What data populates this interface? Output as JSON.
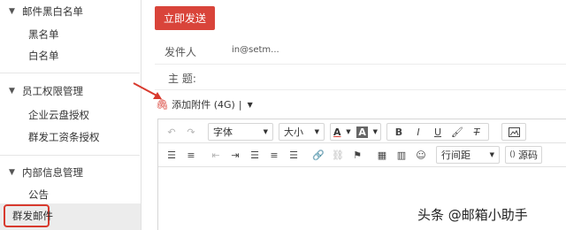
{
  "sidebar": {
    "sections": [
      {
        "title": "邮件黑白名单",
        "items": [
          "黑名单",
          "白名单"
        ]
      },
      {
        "title": "员工权限管理",
        "items": [
          "企业云盘授权",
          "群发工资条授权"
        ]
      },
      {
        "title": "内部信息管理",
        "items": [
          "公告",
          "群发邮件"
        ]
      }
    ],
    "active_item": "群发邮件"
  },
  "compose": {
    "send_label": "立即发送",
    "sender_label": "发件人",
    "sender_value": "in@setm...",
    "subject_label": "主  题:",
    "attach_label": "添加附件 (4G)",
    "attach_sep": "|"
  },
  "toolbar": {
    "font_label": "字体",
    "size_label": "大小",
    "line_height_label": "行间距",
    "source_label": "源码",
    "bold": "B",
    "italic": "I",
    "underline": "U",
    "font_color": "A",
    "bg_color": "A"
  },
  "watermark": "头条 @邮箱小助手",
  "colors": {
    "accent": "#d9443a",
    "active_box": "#d83a2e"
  },
  "icons": [
    "undo-icon",
    "redo-icon",
    "brush-icon",
    "clear-format-icon",
    "image-icon",
    "ordered-list-icon",
    "unordered-list-icon",
    "outdent-icon",
    "indent-icon",
    "align-left-icon",
    "align-center-icon",
    "align-right-icon",
    "link-icon",
    "unlink-icon",
    "flag-icon",
    "table-icon",
    "columns-icon",
    "emoji-icon",
    "source-icon",
    "paperclip-icon",
    "chevron-down-icon"
  ]
}
